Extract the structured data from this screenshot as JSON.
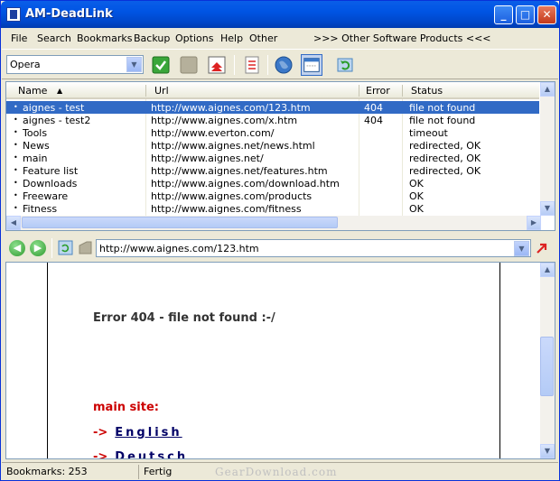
{
  "window": {
    "title": "AM-DeadLink",
    "minimize": "_",
    "maximize": "□",
    "close": "✕"
  },
  "menu": {
    "items": [
      "File",
      "Search",
      "Bookmarks",
      "Backup",
      "Options",
      "Help",
      "Other"
    ],
    "other_products": ">>> Other Software Products <<<"
  },
  "toolbar": {
    "browser_selected": "Opera",
    "icons": [
      "check-icon",
      "stop-icon",
      "import-icon",
      "list-icon",
      "globe-icon",
      "window-icon",
      "refresh-icon"
    ]
  },
  "list": {
    "columns": [
      "Name",
      "Url",
      "Error",
      "Status"
    ],
    "rows": [
      {
        "name": "aignes - test",
        "url": "http://www.aignes.com/123.htm",
        "error": "404",
        "status": "file not found"
      },
      {
        "name": "aignes - test2",
        "url": "http://www.aignes.com/x.htm",
        "error": "404",
        "status": "file not found"
      },
      {
        "name": "Tools",
        "url": "http://www.everton.com/",
        "error": "",
        "status": "timeout"
      },
      {
        "name": "News",
        "url": "http://www.aignes.net/news.html",
        "error": "",
        "status": "redirected, OK"
      },
      {
        "name": "main",
        "url": "http://www.aignes.net/",
        "error": "",
        "status": "redirected, OK"
      },
      {
        "name": "Feature list",
        "url": "http://www.aignes.net/features.htm",
        "error": "",
        "status": "redirected, OK"
      },
      {
        "name": "Downloads",
        "url": "http://www.aignes.com/download.htm",
        "error": "",
        "status": "OK"
      },
      {
        "name": "Freeware",
        "url": "http://www.aignes.com/products",
        "error": "",
        "status": "OK"
      },
      {
        "name": "Fitness",
        "url": "http://www.aignes.com/fitness",
        "error": "",
        "status": "OK"
      }
    ]
  },
  "nav": {
    "address": "http://www.aignes.com/123.htm"
  },
  "page": {
    "error_text": "Error 404 - file not found  :-/",
    "main_site": "main site:",
    "arrow": "->",
    "lang1": "English",
    "lang2": "Deutsch"
  },
  "status": {
    "bookmarks": "Bookmarks: 253",
    "state": "Fertig",
    "watermark": "GearDownload.com"
  }
}
